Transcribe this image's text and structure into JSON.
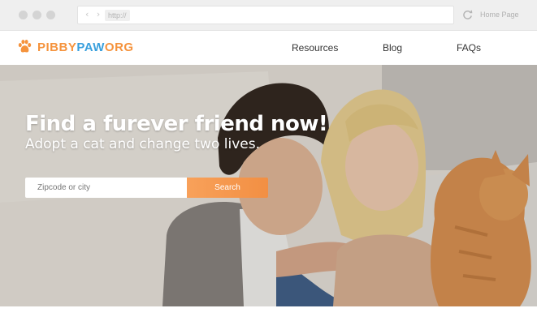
{
  "browser": {
    "nav_arrows": "‹ ›",
    "url": "http://",
    "home_page_label": "Home Page"
  },
  "site": {
    "logo": {
      "part1": "PIBBY",
      "part2": "PAW",
      "part3": "ORG",
      "colors": {
        "orange": "#f5933d",
        "blue": "#3aa0dd"
      }
    },
    "nav": {
      "resources": "Resources",
      "blog": "Blog",
      "faqs": "FAQs"
    }
  },
  "hero": {
    "headline": "Find a furever friend now!",
    "subheadline": "Adopt a cat and change two lives.",
    "search": {
      "placeholder": "Zipcode or city",
      "button_label": "Search",
      "accent": "#f5933d"
    },
    "image": "couple-with-orange-cat-photo"
  }
}
